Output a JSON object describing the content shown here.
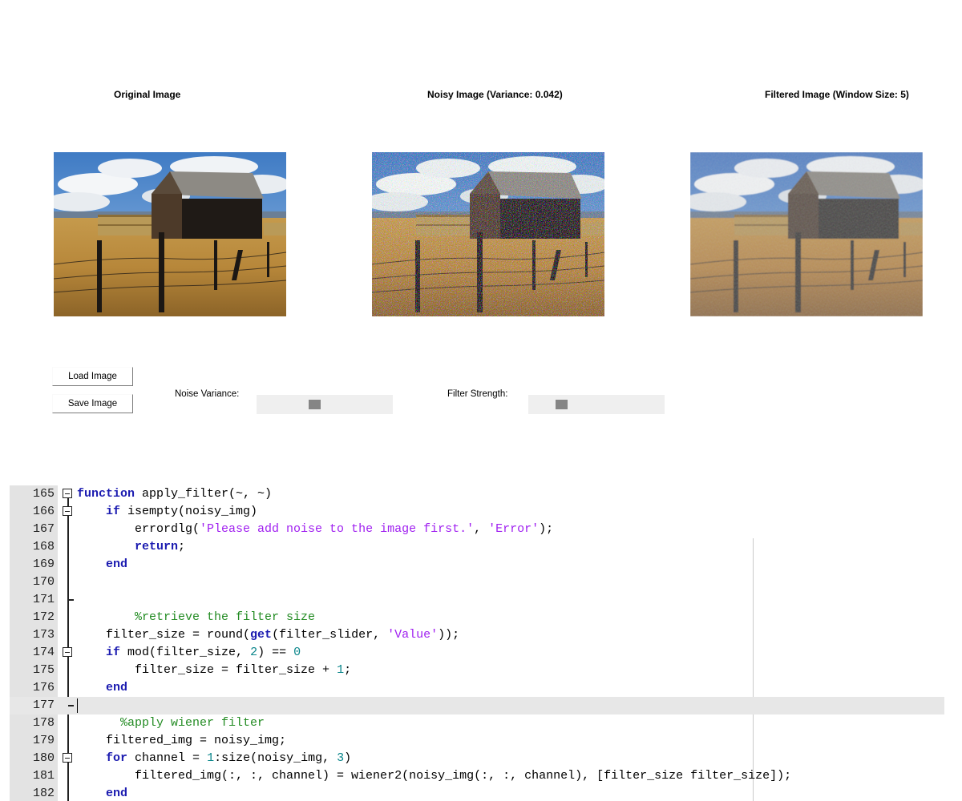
{
  "figure": {
    "panels": [
      {
        "title": "Original Image"
      },
      {
        "title": "Noisy Image (Variance: 0.042)"
      },
      {
        "title": "Filtered Image (Window Size: 5)"
      }
    ],
    "buttons": {
      "load": "Load Image",
      "save": "Save Image"
    },
    "controls": {
      "noise_label": "Noise Variance:",
      "noise_value": 0.42,
      "filter_label": "Filter Strength:",
      "filter_value": 0.22
    }
  },
  "editor": {
    "lines": [
      {
        "n": "165",
        "tokens": [
          {
            "t": "function",
            "c": "kw"
          },
          {
            "t": " apply_filter(~, ~)"
          }
        ]
      },
      {
        "n": "166",
        "tokens": [
          {
            "t": "    "
          },
          {
            "t": "if",
            "c": "kw"
          },
          {
            "t": " isempty(noisy_img)"
          }
        ]
      },
      {
        "n": "167",
        "tokens": [
          {
            "t": "        errordlg("
          },
          {
            "t": "'Please add noise to the image first.'",
            "c": "str"
          },
          {
            "t": ", "
          },
          {
            "t": "'Error'",
            "c": "str"
          },
          {
            "t": ");"
          }
        ]
      },
      {
        "n": "168",
        "tokens": [
          {
            "t": "        "
          },
          {
            "t": "return",
            "c": "kw"
          },
          {
            "t": ";"
          }
        ]
      },
      {
        "n": "169",
        "tokens": [
          {
            "t": "    "
          },
          {
            "t": "end",
            "c": "kw"
          }
        ]
      },
      {
        "n": "170",
        "tokens": []
      },
      {
        "n": "171",
        "tokens": []
      },
      {
        "n": "172",
        "tokens": [
          {
            "t": "        "
          },
          {
            "t": "%retrieve the filter size",
            "c": "cmt"
          }
        ]
      },
      {
        "n": "173",
        "tokens": [
          {
            "t": "    filter_size = round("
          },
          {
            "t": "get",
            "c": "kw"
          },
          {
            "t": "(filter_slider, "
          },
          {
            "t": "'Value'",
            "c": "str"
          },
          {
            "t": "));"
          }
        ]
      },
      {
        "n": "174",
        "tokens": [
          {
            "t": "    "
          },
          {
            "t": "if",
            "c": "kw"
          },
          {
            "t": " mod(filter_size, "
          },
          {
            "t": "2",
            "c": "num"
          },
          {
            "t": ") == "
          },
          {
            "t": "0",
            "c": "num"
          }
        ]
      },
      {
        "n": "175",
        "tokens": [
          {
            "t": "        filter_size = filter_size + "
          },
          {
            "t": "1",
            "c": "num"
          },
          {
            "t": ";"
          }
        ]
      },
      {
        "n": "176",
        "tokens": [
          {
            "t": "    "
          },
          {
            "t": "end",
            "c": "kw"
          }
        ]
      },
      {
        "n": "177",
        "tokens": []
      },
      {
        "n": "178",
        "tokens": [
          {
            "t": "      "
          },
          {
            "t": "%apply wiener filter",
            "c": "cmt"
          }
        ]
      },
      {
        "n": "179",
        "tokens": [
          {
            "t": "    filtered_img = noisy_img;"
          }
        ]
      },
      {
        "n": "180",
        "tokens": [
          {
            "t": "    "
          },
          {
            "t": "for",
            "c": "kw"
          },
          {
            "t": " channel = "
          },
          {
            "t": "1",
            "c": "num"
          },
          {
            "t": ":size(noisy_img, "
          },
          {
            "t": "3",
            "c": "num"
          },
          {
            "t": ")"
          }
        ]
      },
      {
        "n": "181",
        "tokens": [
          {
            "t": "        filtered_img(:, :, channel) = wiener2(noisy_img(:, :, channel), [filter_size filter_size]);"
          }
        ]
      },
      {
        "n": "182",
        "tokens": [
          {
            "t": "    "
          },
          {
            "t": "end",
            "c": "kw"
          }
        ]
      }
    ],
    "colors": {
      "keyword": "#1b1bb0",
      "string": "#a020f0",
      "comment": "#228b22",
      "number": "#09858a"
    }
  }
}
